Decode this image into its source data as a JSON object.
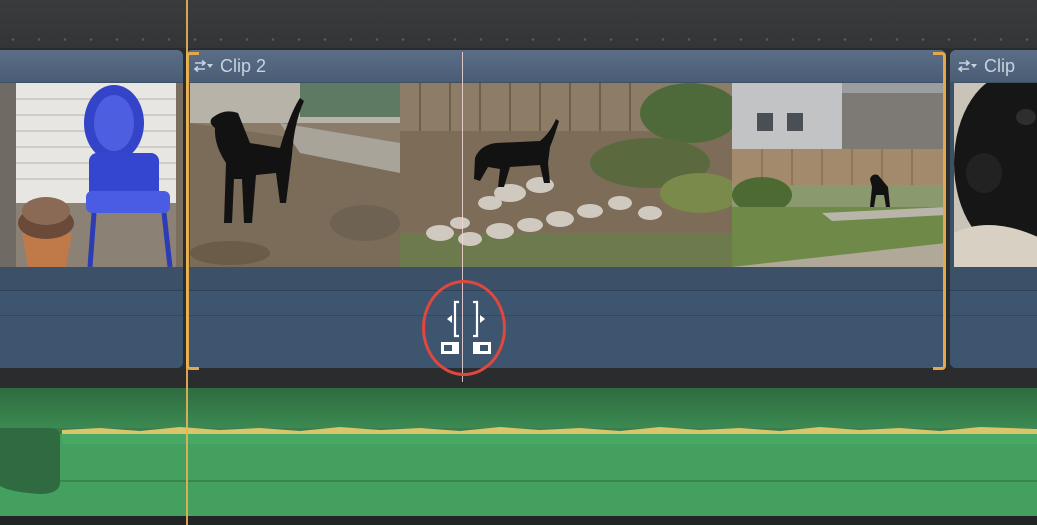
{
  "clips": {
    "left": {
      "label": ""
    },
    "main": {
      "label": "Clip 2"
    },
    "right": {
      "label": "Clip"
    }
  },
  "icons": {
    "clip_menu": "clip-menu-icon",
    "trim": "ripple-trim-icon"
  },
  "colors": {
    "clip_fill": "#3c5068",
    "clip_header": "#54677f",
    "selection_bracket": "#e3a84a",
    "playhead": "#e8b259",
    "highlight_ring": "#e0473d",
    "audio_fill": "#44a05e",
    "waveform_peak": "#d9c56a"
  }
}
